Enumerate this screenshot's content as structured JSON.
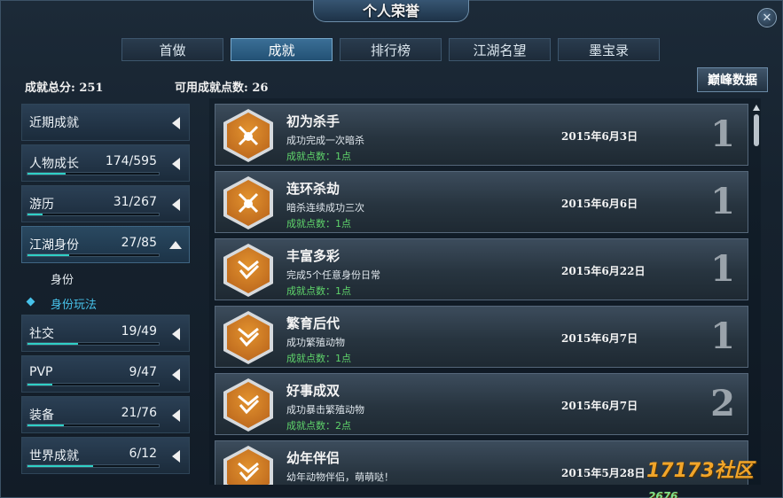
{
  "window": {
    "title": "个人荣誉"
  },
  "tabs": [
    {
      "label": "首做",
      "active": false
    },
    {
      "label": "成就",
      "active": true
    },
    {
      "label": "排行榜",
      "active": false
    },
    {
      "label": "江湖名望",
      "active": false
    },
    {
      "label": "墨宝录",
      "active": false
    }
  ],
  "stats": {
    "total_label": "成就总分: 251",
    "available_label": "可用成就点数: 26"
  },
  "peak_button": "巅峰数据",
  "categories": [
    {
      "name": "近期成就",
      "count": "",
      "progress": null
    },
    {
      "name": "人物成长",
      "count": "174/595",
      "progress": 0.292
    },
    {
      "name": "游历",
      "count": "31/267",
      "progress": 0.116
    },
    {
      "name": "江湖身份",
      "count": "27/85",
      "progress": 0.318
    },
    {
      "name": "社交",
      "count": "19/49",
      "progress": 0.388
    },
    {
      "name": "PVP",
      "count": "9/47",
      "progress": 0.191
    },
    {
      "name": "装备",
      "count": "21/76",
      "progress": 0.276
    },
    {
      "name": "世界成就",
      "count": "6/12",
      "progress": 0.5
    }
  ],
  "subcategories": [
    {
      "name": "身份",
      "selected": false
    },
    {
      "name": "身份玩法",
      "selected": true
    }
  ],
  "achievements": [
    {
      "title": "初为杀手",
      "desc": "成功完成一次暗杀",
      "points": "成就点数：1点",
      "date": "2015年6月3日",
      "tier": "1",
      "icon": "assassin-icon"
    },
    {
      "title": "连环杀劫",
      "desc": "暗杀连续成功三次",
      "points": "成就点数：1点",
      "date": "2015年6月6日",
      "tier": "1",
      "icon": "assassin-icon"
    },
    {
      "title": "丰富多彩",
      "desc": "完成5个任意身份日常",
      "points": "成就点数：1点",
      "date": "2015年6月22日",
      "tier": "1",
      "icon": "check-chevron-icon"
    },
    {
      "title": "繁育后代",
      "desc": "成功繁殖动物",
      "points": "成就点数：1点",
      "date": "2015年6月7日",
      "tier": "1",
      "icon": "check-chevron-icon"
    },
    {
      "title": "好事成双",
      "desc": "成功暴击繁殖动物",
      "points": "成就点数：2点",
      "date": "2015年6月7日",
      "tier": "2",
      "icon": "check-chevron-icon"
    },
    {
      "title": "幼年伴侣",
      "desc": "幼年动物伴侣，萌萌哒！",
      "points": "",
      "date": "2015年5月28日",
      "tier": "",
      "icon": "check-chevron-icon"
    }
  ],
  "watermark": {
    "main": "17173社区",
    "sub": "2676"
  },
  "colors": {
    "accent": "#2fd0c6",
    "points_green": "#5fd46b",
    "badge_orange": "#d8822a",
    "selected_blue": "#47c2ea"
  }
}
